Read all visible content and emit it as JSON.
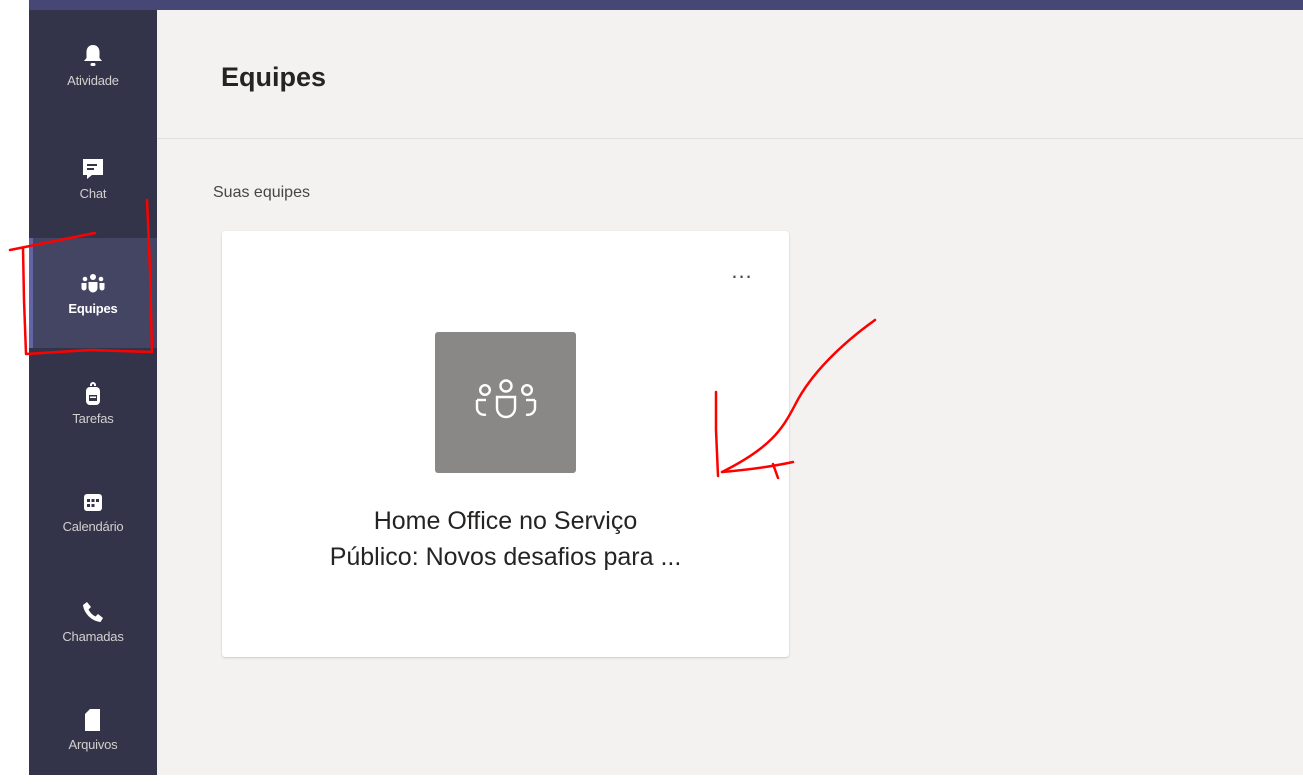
{
  "rail": {
    "items": [
      {
        "label": "Atividade",
        "icon": "bell-icon"
      },
      {
        "label": "Chat",
        "icon": "chat-icon"
      },
      {
        "label": "Equipes",
        "icon": "teams-icon",
        "active": true
      },
      {
        "label": "Tarefas",
        "icon": "backpack-icon"
      },
      {
        "label": "Calendário",
        "icon": "calendar-icon"
      },
      {
        "label": "Chamadas",
        "icon": "phone-icon"
      },
      {
        "label": "Arquivos",
        "icon": "file-icon"
      }
    ]
  },
  "main": {
    "title": "Equipes",
    "section_label": "Suas equipes",
    "team_card": {
      "more_label": "...",
      "avatar_icon": "team-people-icon",
      "name_line1": "Home Office no Serviço",
      "name_line2": "Público: Novos desafios para ..."
    }
  },
  "colors": {
    "rail_background": "#33344a",
    "accent": "#6264a7",
    "main_background": "#f3f2f1",
    "avatar_background": "#8a8886",
    "annotation": "#ff0000"
  }
}
